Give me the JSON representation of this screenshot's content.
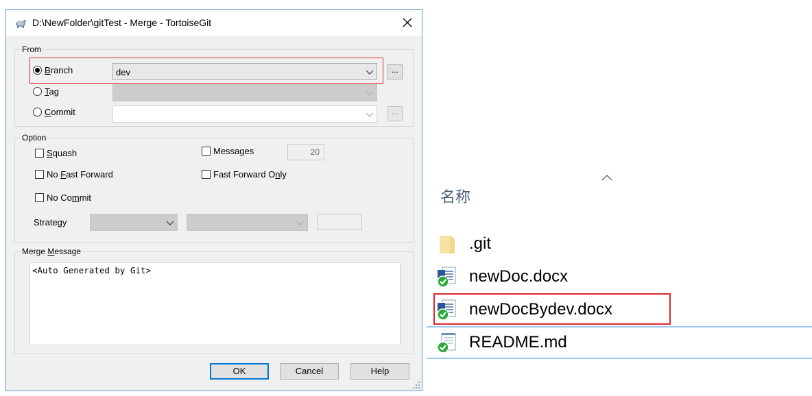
{
  "dialog": {
    "title": "D:\\NewFolder\\gitTest - Merge - TortoiseGit",
    "from": {
      "group_label": "From",
      "branch_label_prefix": "",
      "branch_label_access": "B",
      "branch_label_rest": "ranch",
      "tag_label_access": "T",
      "tag_label_rest": "ag",
      "commit_label_access": "C",
      "commit_label_rest": "ommit",
      "branch_value": "dev",
      "browse_label": "...",
      "selected": "Branch"
    },
    "option": {
      "group_label": "Option",
      "squash_access": "S",
      "squash_rest": "quash",
      "no_ff_pre": "No ",
      "no_ff_access": "F",
      "no_ff_rest": "ast Forward",
      "no_commit_pre": "No Co",
      "no_commit_access": "m",
      "no_commit_rest": "mit",
      "messages_label": "Messages",
      "messages_count": "20",
      "ff_only_pre": "Fast Forward O",
      "ff_only_access": "n",
      "ff_only_rest": "ly",
      "strategy_label": "Strategy"
    },
    "merge_message": {
      "group_label_pre": "Merge ",
      "group_label_access": "M",
      "group_label_rest": "essage",
      "text": "<Auto Generated by Git>"
    },
    "buttons": {
      "ok": "OK",
      "cancel": "Cancel",
      "help": "Help"
    }
  },
  "explorer": {
    "column_header": "名称",
    "files": [
      {
        "name": ".git",
        "icon": "folder-icon"
      },
      {
        "name": "newDoc.docx",
        "icon": "word-doc-icon"
      },
      {
        "name": "newDocBydev.docx",
        "icon": "word-doc-icon"
      },
      {
        "name": "README.md",
        "icon": "text-file-icon"
      }
    ]
  },
  "colors": {
    "highlight_red": "#e0262b",
    "accent_blue": "#0078d7",
    "git_green": "#2eaa3c"
  }
}
